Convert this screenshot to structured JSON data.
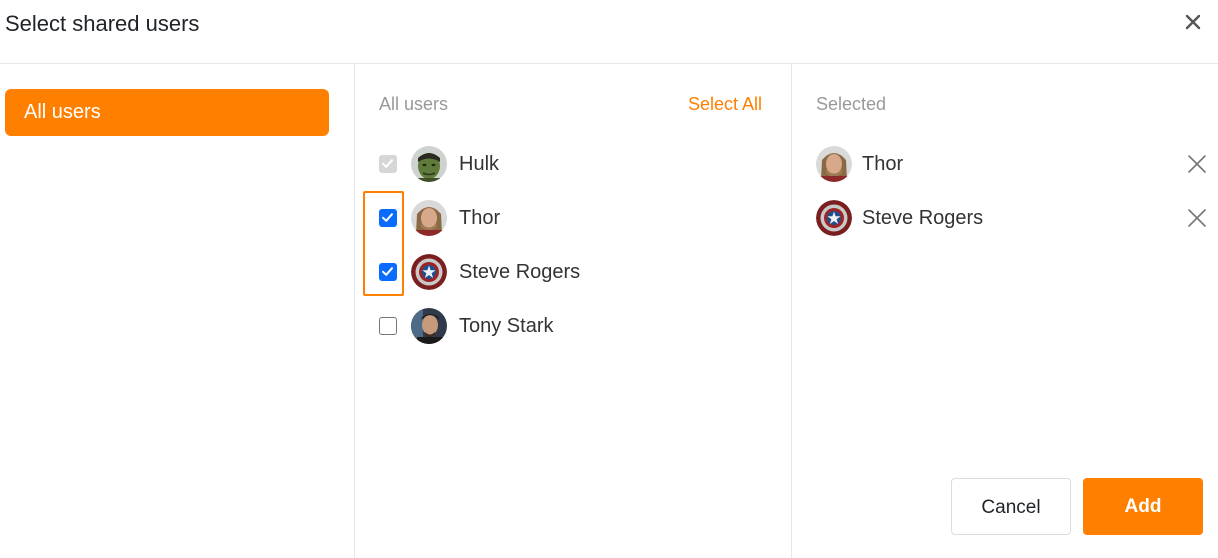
{
  "dialog": {
    "title": "Select shared users",
    "close_icon": "close-icon"
  },
  "sidebar": {
    "items": [
      {
        "label": "All users",
        "active": true
      }
    ]
  },
  "user_list": {
    "heading": "All users",
    "select_all_label": "Select All",
    "users": [
      {
        "name": "Hulk",
        "checked": true,
        "disabled": true,
        "avatar": "hulk-avatar"
      },
      {
        "name": "Thor",
        "checked": true,
        "disabled": false,
        "avatar": "thor-avatar"
      },
      {
        "name": "Steve Rogers",
        "checked": true,
        "disabled": false,
        "avatar": "captain-shield-avatar"
      },
      {
        "name": "Tony Stark",
        "checked": false,
        "disabled": false,
        "avatar": "tony-stark-avatar"
      }
    ]
  },
  "selected_panel": {
    "heading": "Selected",
    "users": [
      {
        "name": "Thor",
        "avatar": "thor-avatar"
      },
      {
        "name": "Steve Rogers",
        "avatar": "captain-shield-avatar"
      }
    ]
  },
  "footer": {
    "cancel_label": "Cancel",
    "add_label": "Add"
  },
  "colors": {
    "accent": "#ff8000",
    "checkbox_checked": "#0a6cff",
    "checkbox_disabled": "#d6d6d6",
    "divider": "#e8e8e8",
    "muted_text": "#999999"
  }
}
